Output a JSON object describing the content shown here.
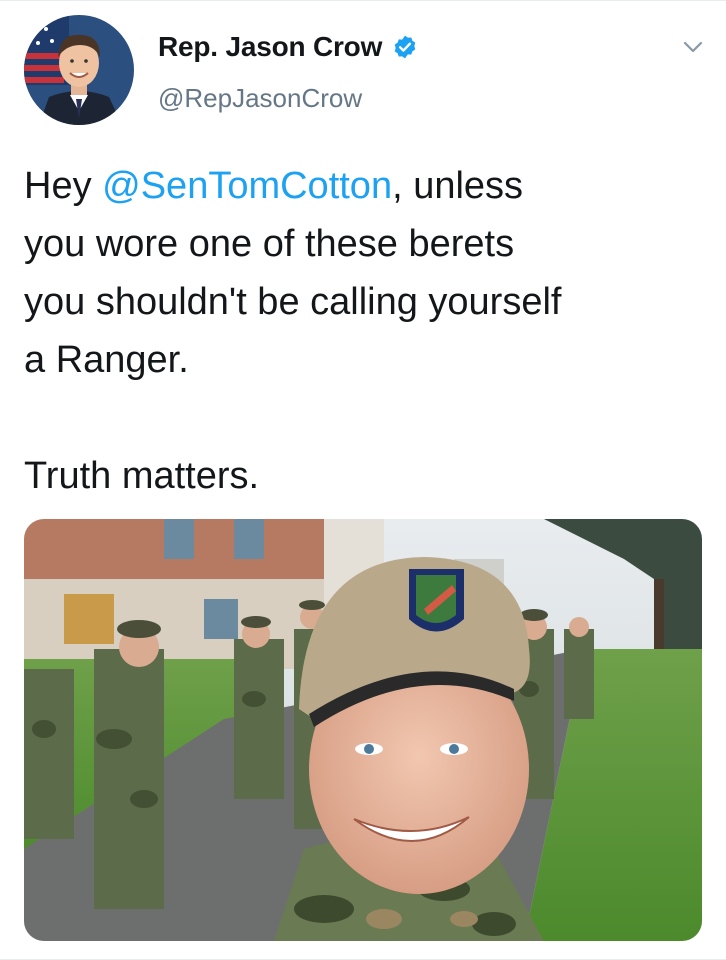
{
  "author": {
    "display_name": "Rep. Jason Crow",
    "handle": "@RepJasonCrow",
    "verified": true,
    "avatar_icon": "profile-photo",
    "verified_icon": "verified-badge-icon"
  },
  "menu_icon": "chevron-down-icon",
  "tweet": {
    "prefix": "Hey ",
    "mention": "@SenTomCotton",
    "line1_rest": ", unless",
    "line2": "you wore one of these berets",
    "line3": "you shouldn't be calling yourself",
    "line4": "a Ranger.",
    "line5": "Truth matters."
  },
  "media": {
    "type": "photo",
    "description_icon": "attached-photo"
  },
  "colors": {
    "link": "#1da1f2",
    "text": "#14171a",
    "secondary": "#657786",
    "verified": "#1da1f2"
  }
}
